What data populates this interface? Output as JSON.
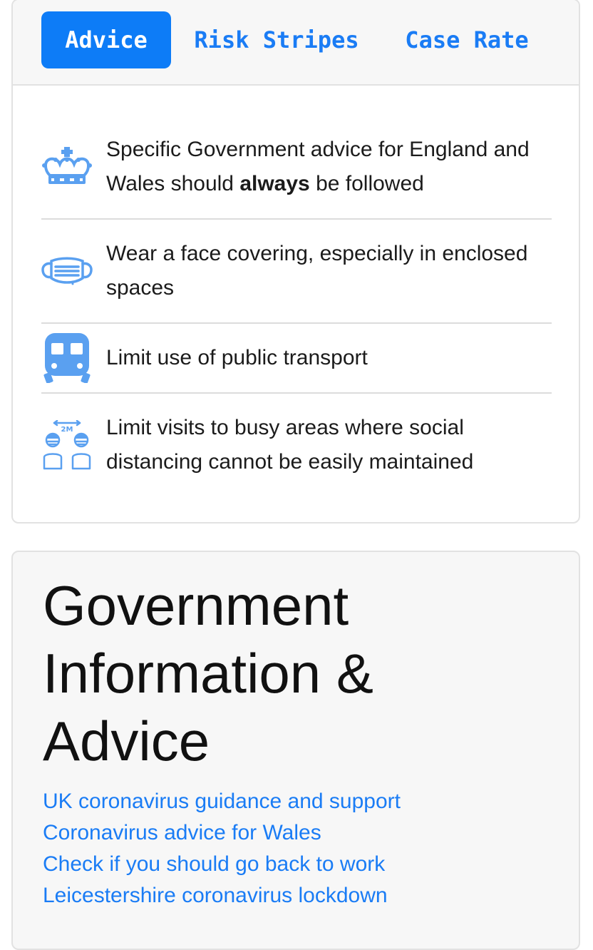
{
  "colors": {
    "accent": "#0d7cf7",
    "link": "#1a7cf5",
    "icon": "#5aa0f0",
    "panel": "#f7f7f7",
    "border": "#e2e2e2"
  },
  "tabs": [
    {
      "label": "Advice",
      "active": true
    },
    {
      "label": "Risk Stripes",
      "active": false
    },
    {
      "label": "Case Rate",
      "active": false
    }
  ],
  "advice": [
    {
      "icon": "crown-icon",
      "text_before": "Specific Government advice for England and Wales should ",
      "text_bold": "always",
      "text_after": " be followed"
    },
    {
      "icon": "face-mask-icon",
      "text": "Wear a face covering, especially in enclosed spaces"
    },
    {
      "icon": "train-icon",
      "text": "Limit use of public transport"
    },
    {
      "icon": "social-distancing-icon",
      "icon_label": "2M",
      "text": "Limit visits to busy areas where social distancing cannot be easily maintained"
    }
  ],
  "info": {
    "title": "Government Information & Advice",
    "links": [
      "UK coronavirus guidance and support",
      "Coronavirus advice for Wales",
      "Check if you should go back to work",
      "Leicestershire coronavirus lockdown"
    ]
  }
}
